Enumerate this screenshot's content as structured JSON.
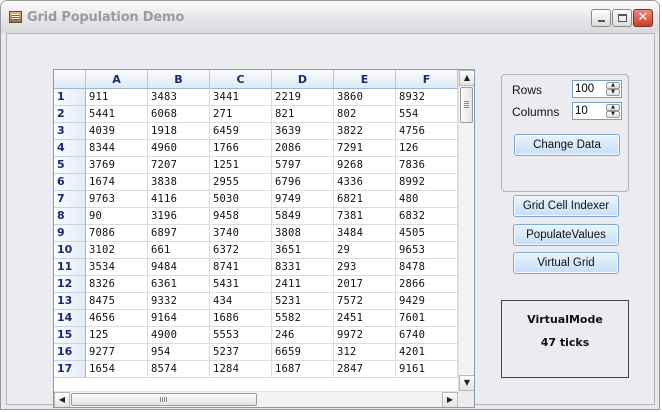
{
  "window": {
    "title": "Grid Population Demo",
    "close_symbol": "✕",
    "icons": {
      "app": "grid-app-icon",
      "minimize": "minimize-icon",
      "maximize": "maximize-icon",
      "close": "close-icon"
    }
  },
  "grid": {
    "columns": [
      "A",
      "B",
      "C",
      "D",
      "E",
      "F"
    ],
    "rows": [
      {
        "n": "1",
        "cells": [
          "911",
          "3483",
          "3441",
          "2219",
          "3860",
          "8932"
        ]
      },
      {
        "n": "2",
        "cells": [
          "5441",
          "6068",
          "271",
          "821",
          "802",
          "554"
        ]
      },
      {
        "n": "3",
        "cells": [
          "4039",
          "1918",
          "6459",
          "3639",
          "3822",
          "4756"
        ]
      },
      {
        "n": "4",
        "cells": [
          "8344",
          "4960",
          "1766",
          "2086",
          "7291",
          "126"
        ]
      },
      {
        "n": "5",
        "cells": [
          "3769",
          "7207",
          "1251",
          "5797",
          "9268",
          "7836"
        ]
      },
      {
        "n": "6",
        "cells": [
          "1674",
          "3838",
          "2955",
          "6796",
          "4336",
          "8992"
        ]
      },
      {
        "n": "7",
        "cells": [
          "9763",
          "4116",
          "5030",
          "9749",
          "6821",
          "480"
        ]
      },
      {
        "n": "8",
        "cells": [
          "90",
          "3196",
          "9458",
          "5849",
          "7381",
          "6832"
        ]
      },
      {
        "n": "9",
        "cells": [
          "7086",
          "6897",
          "3740",
          "3808",
          "3484",
          "4505"
        ]
      },
      {
        "n": "10",
        "cells": [
          "3102",
          "661",
          "6372",
          "3651",
          "29",
          "9653"
        ]
      },
      {
        "n": "11",
        "cells": [
          "3534",
          "9484",
          "8741",
          "8331",
          "293",
          "8478"
        ]
      },
      {
        "n": "12",
        "cells": [
          "8326",
          "6361",
          "5431",
          "2411",
          "2017",
          "2866"
        ]
      },
      {
        "n": "13",
        "cells": [
          "8475",
          "9332",
          "434",
          "5231",
          "7572",
          "9429"
        ]
      },
      {
        "n": "14",
        "cells": [
          "4656",
          "9164",
          "1686",
          "5582",
          "2451",
          "7601"
        ]
      },
      {
        "n": "15",
        "cells": [
          "125",
          "4900",
          "5553",
          "246",
          "9972",
          "6740"
        ]
      },
      {
        "n": "16",
        "cells": [
          "9277",
          "954",
          "5237",
          "6659",
          "312",
          "4201"
        ]
      },
      {
        "n": "17",
        "cells": [
          "1654",
          "8574",
          "1284",
          "1687",
          "2847",
          "9161"
        ]
      }
    ],
    "scroll_arrows": {
      "up": "▲",
      "down": "▼",
      "left": "◀",
      "right": "▶"
    }
  },
  "settings": {
    "rows_label": "Rows",
    "rows_value": "100",
    "columns_label": "Columns",
    "columns_value": "10",
    "spin_up": "▲",
    "spin_down": "▼",
    "change_data_button": "Change Data"
  },
  "actions": {
    "grid_cell_indexer": "Grid Cell Indexer",
    "populate_values": "PopulateValues",
    "virtual_grid": "Virtual Grid"
  },
  "result": {
    "mode": "VirtualMode",
    "ticks": "47 ticks"
  }
}
